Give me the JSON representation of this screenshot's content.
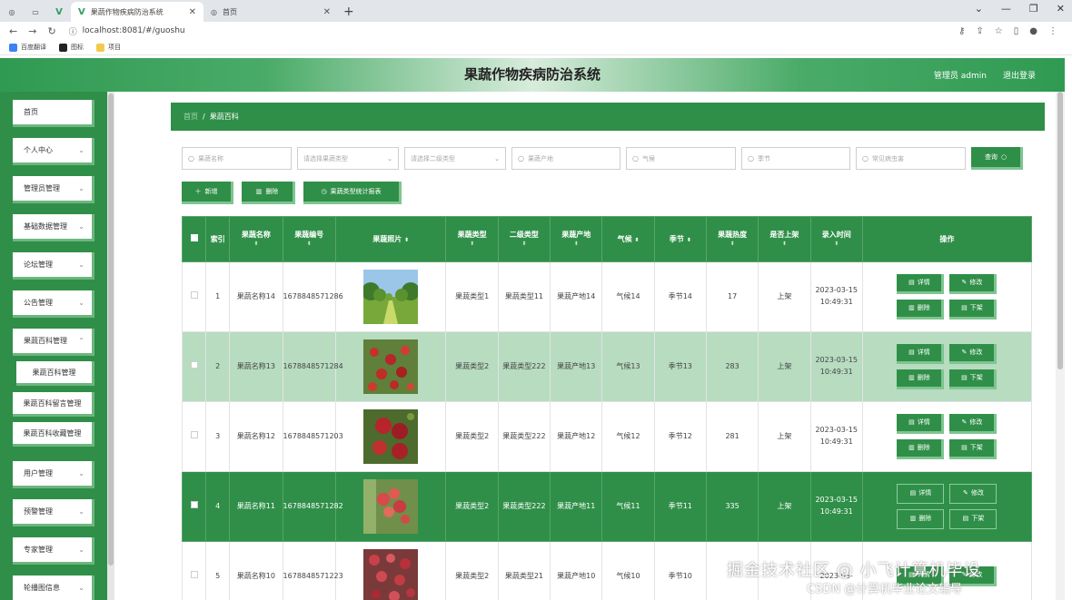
{
  "browser": {
    "tabs": [
      {
        "label": "果蔬作物疾病防治系统",
        "active": true
      },
      {
        "label": "首页",
        "active": false
      }
    ],
    "url": "localhost:8081/#/guoshu",
    "bookmarks": [
      "百度翻译",
      "图标",
      "项目"
    ]
  },
  "header": {
    "title": "果蔬作物疾病防治系统",
    "user_label": "管理员 admin",
    "logout_label": "退出登录"
  },
  "sidebar": {
    "items": [
      {
        "label": "首页",
        "chevron": false
      },
      {
        "label": "个人中心",
        "chevron": true
      },
      {
        "label": "管理员管理",
        "chevron": true
      },
      {
        "label": "基础数据管理",
        "chevron": true
      },
      {
        "label": "论坛管理",
        "chevron": true
      },
      {
        "label": "公告管理",
        "chevron": true
      },
      {
        "label": "果蔬百科管理",
        "chevron": true
      }
    ],
    "subitems": [
      "果蔬百科管理",
      "果蔬百科留言管理",
      "果蔬百科收藏管理"
    ],
    "items2": [
      {
        "label": "用户管理",
        "chevron": true
      },
      {
        "label": "预警管理",
        "chevron": true
      },
      {
        "label": "专家管理",
        "chevron": true
      },
      {
        "label": "轮播图信息",
        "chevron": true
      }
    ]
  },
  "breadcrumb": {
    "home": "首页",
    "sep": "/",
    "current": "果蔬百科"
  },
  "filters": {
    "name_placeholder": "果蔬名称",
    "type_placeholder": "请选择果蔬类型",
    "subtype_placeholder": "请选择二级类型",
    "origin_placeholder": "果蔬产地",
    "climate_placeholder": "气候",
    "season_placeholder": "季节",
    "pest_placeholder": "常见病虫害",
    "search_label": "查询"
  },
  "actions": {
    "add": "新增",
    "delete": "删除",
    "report": "果蔬类型统计报表"
  },
  "table": {
    "headers": [
      "索引",
      "果蔬名称",
      "果蔬编号",
      "果蔬照片",
      "果蔬类型",
      "二级类型",
      "果蔬产地",
      "气候",
      "季节",
      "果蔬热度",
      "是否上架",
      "录入时间",
      "操作"
    ],
    "ops": {
      "detail": "详情",
      "edit": "修改",
      "delete": "删除",
      "offshelf": "下架"
    },
    "rows": [
      {
        "index": "1",
        "name": "果蔬名称14",
        "code": "1678848571286",
        "type": "果蔬类型1",
        "subtype": "果蔬类型11",
        "origin": "果蔬产地14",
        "climate": "气候14",
        "season": "季节14",
        "heat": "17",
        "shelf": "上架",
        "time": "2023-03-15 10:49:31"
      },
      {
        "index": "2",
        "name": "果蔬名称13",
        "code": "1678848571284",
        "type": "果蔬类型2",
        "subtype": "果蔬类型222",
        "origin": "果蔬产地13",
        "climate": "气候13",
        "season": "季节13",
        "heat": "283",
        "shelf": "上架",
        "time": "2023-03-15 10:49:31"
      },
      {
        "index": "3",
        "name": "果蔬名称12",
        "code": "1678848571203",
        "type": "果蔬类型2",
        "subtype": "果蔬类型222",
        "origin": "果蔬产地12",
        "climate": "气候12",
        "season": "季节12",
        "heat": "281",
        "shelf": "上架",
        "time": "2023-03-15 10:49:31"
      },
      {
        "index": "4",
        "name": "果蔬名称11",
        "code": "1678848571282",
        "type": "果蔬类型2",
        "subtype": "果蔬类型222",
        "origin": "果蔬产地11",
        "climate": "气候11",
        "season": "季节11",
        "heat": "335",
        "shelf": "上架",
        "time": "2023-03-15 10:49:31"
      },
      {
        "index": "5",
        "name": "果蔬名称10",
        "code": "1678848571223",
        "type": "果蔬类型2",
        "subtype": "果蔬类型21",
        "origin": "果蔬产地10",
        "climate": "气候10",
        "season": "季节10",
        "heat": "",
        "shelf": "",
        "time": "2023-03-"
      }
    ]
  },
  "watermark": {
    "line1": "掘金技术社区 @ 小飞计算机毕设",
    "line2": "CSDN @计算机毕业论文辅导"
  }
}
